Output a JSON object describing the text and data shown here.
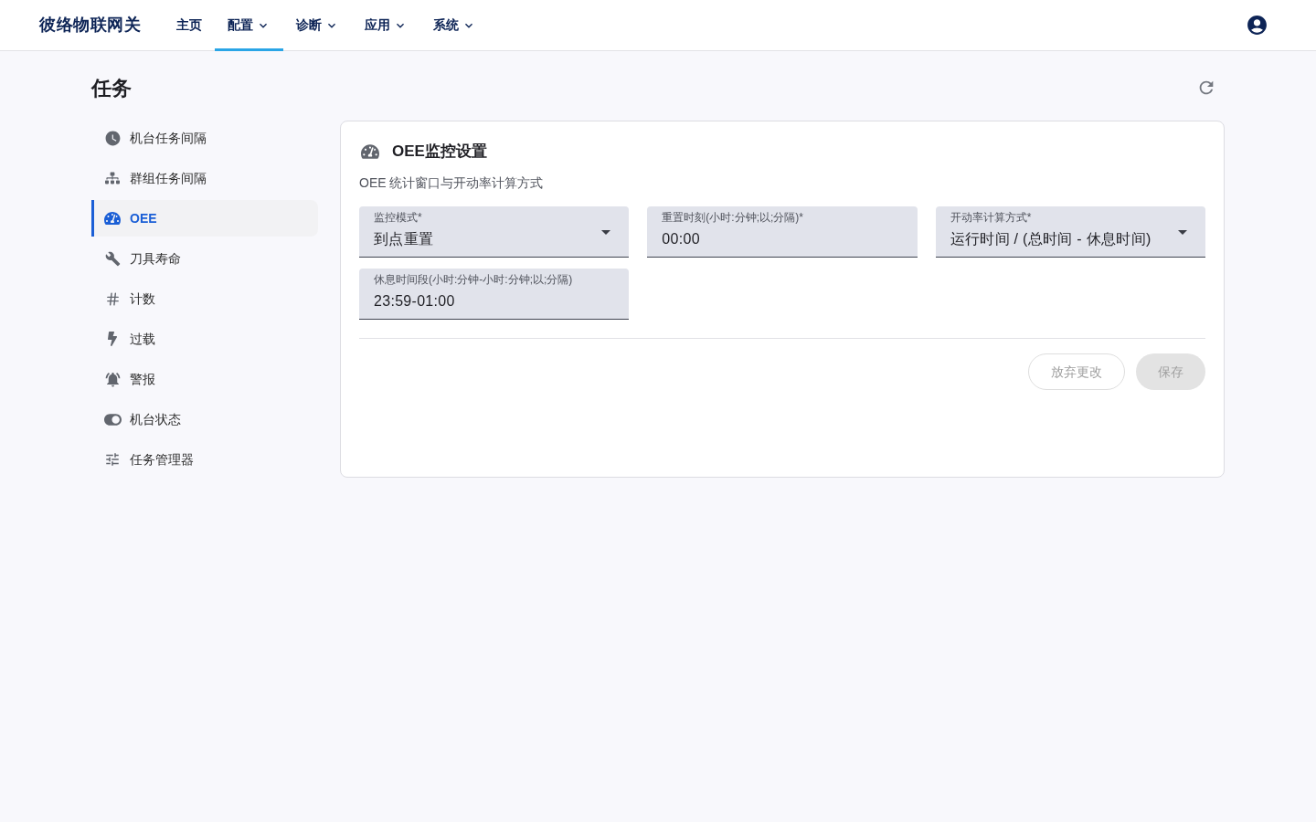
{
  "header": {
    "logo": "彼络物联网关",
    "nav": [
      {
        "label": "主页",
        "dropdown": false,
        "selected": false
      },
      {
        "label": "配置",
        "dropdown": true,
        "selected": true
      },
      {
        "label": "诊断",
        "dropdown": true,
        "selected": false
      },
      {
        "label": "应用",
        "dropdown": true,
        "selected": false
      },
      {
        "label": "系统",
        "dropdown": true,
        "selected": false
      }
    ]
  },
  "page": {
    "title": "任务"
  },
  "sidebar": {
    "items": [
      {
        "label": "机台任务间隔",
        "selected": false
      },
      {
        "label": "群组任务间隔",
        "selected": false
      },
      {
        "label": "OEE",
        "selected": true
      },
      {
        "label": "刀具寿命",
        "selected": false
      },
      {
        "label": "计数",
        "selected": false
      },
      {
        "label": "过载",
        "selected": false
      },
      {
        "label": "警报",
        "selected": false
      },
      {
        "label": "机台状态",
        "selected": false
      },
      {
        "label": "任务管理器",
        "selected": false
      }
    ]
  },
  "card": {
    "title": "OEE监控设置",
    "subtitle": "OEE 统计窗口与开动率计算方式",
    "fields": [
      {
        "kind": "select",
        "label": "监控模式*",
        "value": "到点重置"
      },
      {
        "kind": "text",
        "label": "重置时刻(小时:分钟;以;分隔)*",
        "value": "00:00"
      },
      {
        "kind": "select",
        "label": "开动率计算方式*",
        "value": "运行时间 / (总时间 - 休息时间)"
      },
      {
        "kind": "text",
        "label": "休息时间段(小时:分钟-小时:分钟;以;分隔)",
        "value": "23:59-01:00"
      }
    ],
    "buttons": [
      {
        "label": "放弃更改",
        "kind": "outlined",
        "disabled": true
      },
      {
        "label": "保存",
        "kind": "filled",
        "disabled": true
      }
    ]
  }
}
